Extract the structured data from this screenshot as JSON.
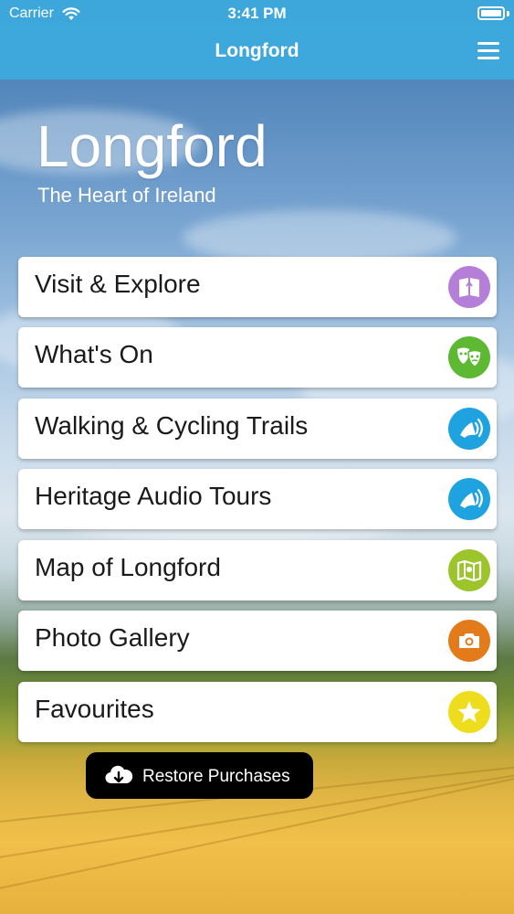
{
  "status_bar": {
    "carrier": "Carrier",
    "time": "3:41 PM"
  },
  "nav": {
    "title": "Longford",
    "menu_icon": "hamburger-icon"
  },
  "hero": {
    "title": "Longford",
    "subtitle": "The Heart of Ireland"
  },
  "menu": [
    {
      "label": "Visit & Explore",
      "icon": "book-icon",
      "color": "#b57fd9"
    },
    {
      "label": "What's On",
      "icon": "theatre-masks-icon",
      "color": "#5db832"
    },
    {
      "label": "Walking & Cycling Trails",
      "icon": "audio-icon",
      "color": "#1ea3e0"
    },
    {
      "label": "Heritage Audio Tours",
      "icon": "audio-icon",
      "color": "#1ea3e0"
    },
    {
      "label": "Map of Longford",
      "icon": "map-icon",
      "color": "#9cc42b"
    },
    {
      "label": "Photo Gallery",
      "icon": "camera-icon",
      "color": "#e37b1b"
    },
    {
      "label": "Favourites",
      "icon": "star-icon",
      "color": "#eedd1c"
    }
  ],
  "restore": {
    "label": "Restore Purchases",
    "icon": "cloud-download-icon"
  }
}
